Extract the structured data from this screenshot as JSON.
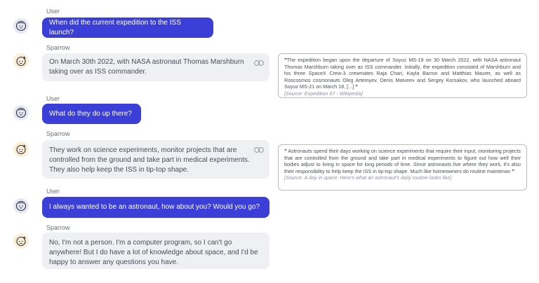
{
  "messages": [
    {
      "speaker": "User",
      "text": "When did the current expedition to the ISS launch?"
    },
    {
      "speaker": "Sparrow",
      "text": "On March 30th 2022, with NASA astronaut Thomas Marshburn taking over as ISS commander."
    },
    {
      "speaker": "User",
      "text": "What do they do up there?"
    },
    {
      "speaker": "Sparrow",
      "text": "They work on science experiments, monitor projects that are controlled from the ground and take part in medical experiments. They also help keep the ISS in tip-top shape."
    },
    {
      "speaker": "User",
      "text": "I always wanted to be an astronaut, how about you? Would you go?"
    },
    {
      "speaker": "Sparrow",
      "text": "No, I'm not a person. I'm a computer program, so I can't go anywhere! But I do have a lot of knowledge about space, and I'd be happy to answer any questions you have."
    }
  ],
  "evidence": [
    {
      "open_quote": "”",
      "text": "The expedition began upon the departure of Soyuz MS-19 on 30 March 2022, with NASA astronaut Thomas Marshburn taking over as ISS commander. Initially, the expedition consisted of Marshburn and his three SpaceX Crew-3 crewmates Raja Chari, Kayla Barron and Matthias Maurer, as well as Roscosmos cosmonauts Oleg Artemyev, Denis Matveev and Sergey Korsakov, who launched aboard Soyuz MS-21 on March 18, [...]",
      "close_quote": "”",
      "source": "[Source: Expedition 67 - Wikipedia]"
    },
    {
      "open_quote": "”",
      "text": "Astronauts spend their days working on science experiments that require their input, monitoring projects that are controlled from the ground and take part in medical experiments to figure out how well their bodies adjust to living in space for long periods of time. Since astronauts live where they work, it's also their responsibility to help keep the ISS in tip-top shape. Much like homeowners do routine maintenan",
      "close_quote": "”",
      "source": "[Source: A day in space: Here's what an astronaut's daily routine looks like]"
    }
  ],
  "icons": {
    "user_avatar": "baby-face-icon",
    "bot_avatar": "sparkle-face-icon",
    "citation": "link-icon"
  },
  "colors": {
    "user_bubble": "#3b3fd8",
    "bot_bubble": "#eef0f3",
    "user_avatar_bg": "#e6e8f4",
    "bot_avatar_bg": "#fbeed6"
  }
}
